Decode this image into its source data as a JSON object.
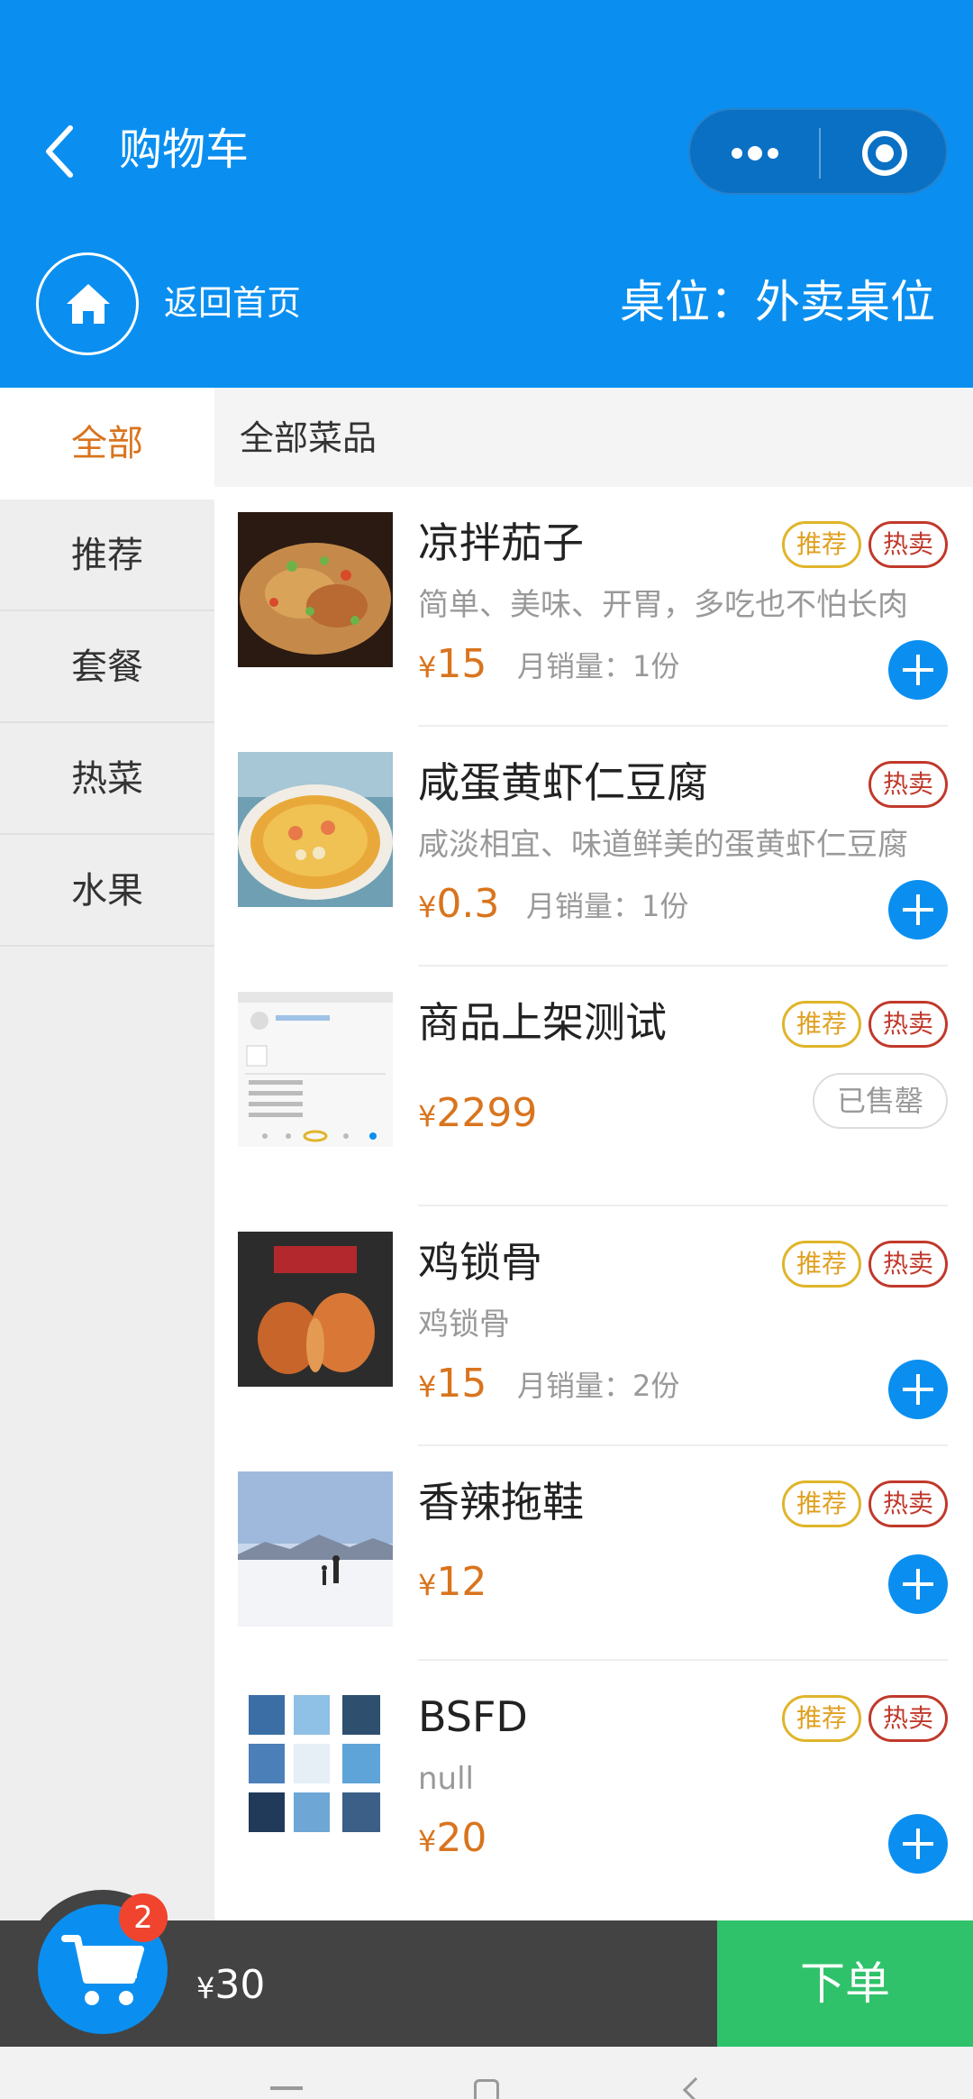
{
  "header": {
    "title": "购物车",
    "home_label": "返回首页",
    "table_label": "桌位：外卖桌位"
  },
  "sidebar": {
    "categories": [
      {
        "label": "全部",
        "active": true
      },
      {
        "label": "推荐",
        "active": false
      },
      {
        "label": "套餐",
        "active": false
      },
      {
        "label": "热菜",
        "active": false
      },
      {
        "label": "水果",
        "active": false
      }
    ]
  },
  "section": {
    "title": "全部菜品"
  },
  "labels": {
    "currency": "¥",
    "recommend_badge": "推荐",
    "hot_badge": "热卖",
    "sold_out": "已售罄"
  },
  "products": [
    {
      "name": "凉拌茄子",
      "desc": "简单、美味、开胃，多吃也不怕长肉",
      "price": "15",
      "sales": "月销量：1份",
      "badges": [
        "推荐",
        "热卖"
      ],
      "action": "add"
    },
    {
      "name": "咸蛋黄虾仁豆腐",
      "desc": "咸淡相宜、味道鲜美的蛋黄虾仁豆腐",
      "price": "0.3",
      "sales": "月销量：1份",
      "badges": [
        "热卖"
      ],
      "action": "add"
    },
    {
      "name": "商品上架测试",
      "desc": "",
      "price": "2299",
      "sales": "",
      "badges": [
        "推荐",
        "热卖"
      ],
      "action": "soldout"
    },
    {
      "name": "鸡锁骨",
      "desc": "鸡锁骨",
      "price": "15",
      "sales": "月销量：2份",
      "badges": [
        "推荐",
        "热卖"
      ],
      "action": "add"
    },
    {
      "name": "香辣拖鞋",
      "desc": "",
      "price": "12",
      "sales": "",
      "badges": [
        "推荐",
        "热卖"
      ],
      "action": "add"
    },
    {
      "name": "BSFD",
      "desc": "null",
      "price": "20",
      "sales": "",
      "badges": [
        "推荐",
        "热卖"
      ],
      "action": "add"
    }
  ],
  "cart": {
    "count": "2",
    "total": "30",
    "order_label": "下单"
  },
  "colors": {
    "primary": "#0a8ff0",
    "accent": "#d9741e",
    "order": "#2fc26a",
    "badge_recommend": "#e0b52a",
    "badge_hot": "#c0392b"
  }
}
